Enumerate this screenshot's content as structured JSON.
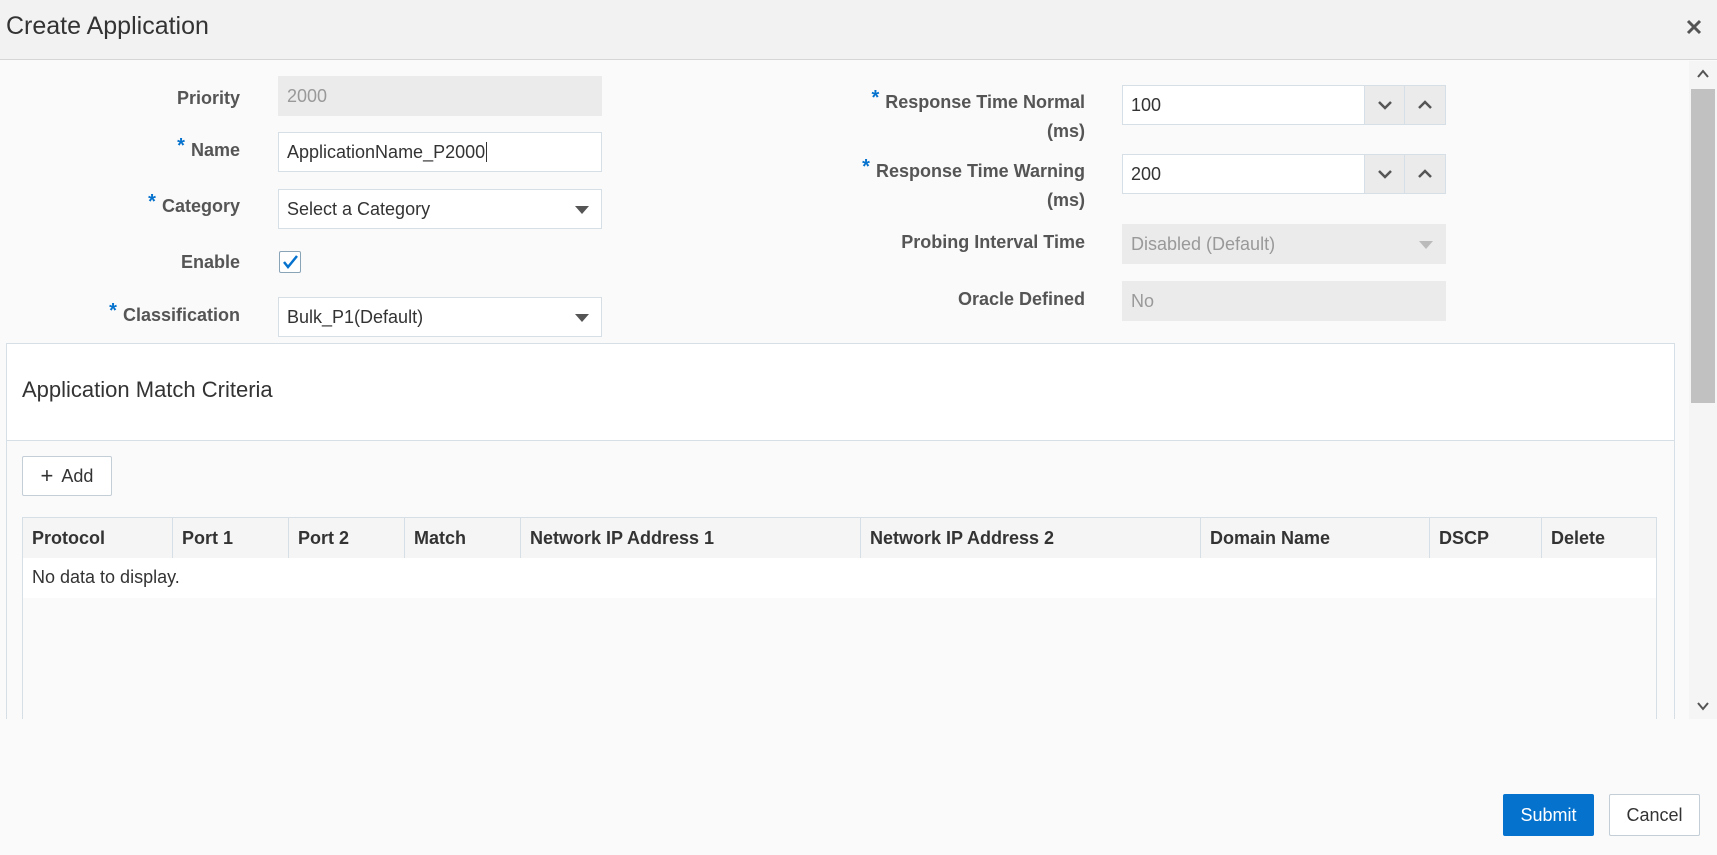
{
  "dialog": {
    "title": "Create Application"
  },
  "form": {
    "priority": {
      "label": "Priority",
      "value": "2000"
    },
    "name": {
      "label": "Name",
      "value": "ApplicationName_P2000",
      "required_marker": "*"
    },
    "category": {
      "label": "Category",
      "value": "Select a Category",
      "required_marker": "*"
    },
    "enable": {
      "label": "Enable",
      "checked": true
    },
    "classification": {
      "label": "Classification",
      "value": "Bulk_P1(Default)",
      "required_marker": "*"
    },
    "response_time_normal": {
      "label": "Response Time Normal",
      "label_unit": "(ms)",
      "value": "100",
      "required_marker": "*"
    },
    "response_time_warning": {
      "label": "Response Time Warning",
      "label_unit": "(ms)",
      "value": "200",
      "required_marker": "*"
    },
    "probing_interval_time": {
      "label": "Probing Interval Time",
      "value": "Disabled (Default)"
    },
    "oracle_defined": {
      "label": "Oracle Defined",
      "value": "No"
    }
  },
  "match_criteria": {
    "title": "Application Match Criteria",
    "add_label": "Add",
    "columns": [
      "Protocol",
      "Port 1",
      "Port 2",
      "Match",
      "Network IP Address 1",
      "Network IP Address 2",
      "Domain Name",
      "DSCP",
      "Delete"
    ],
    "empty_text": "No data to display."
  },
  "footer": {
    "submit_label": "Submit",
    "cancel_label": "Cancel"
  },
  "colors": {
    "accent": "#0572ce",
    "required": "#0572ce"
  }
}
